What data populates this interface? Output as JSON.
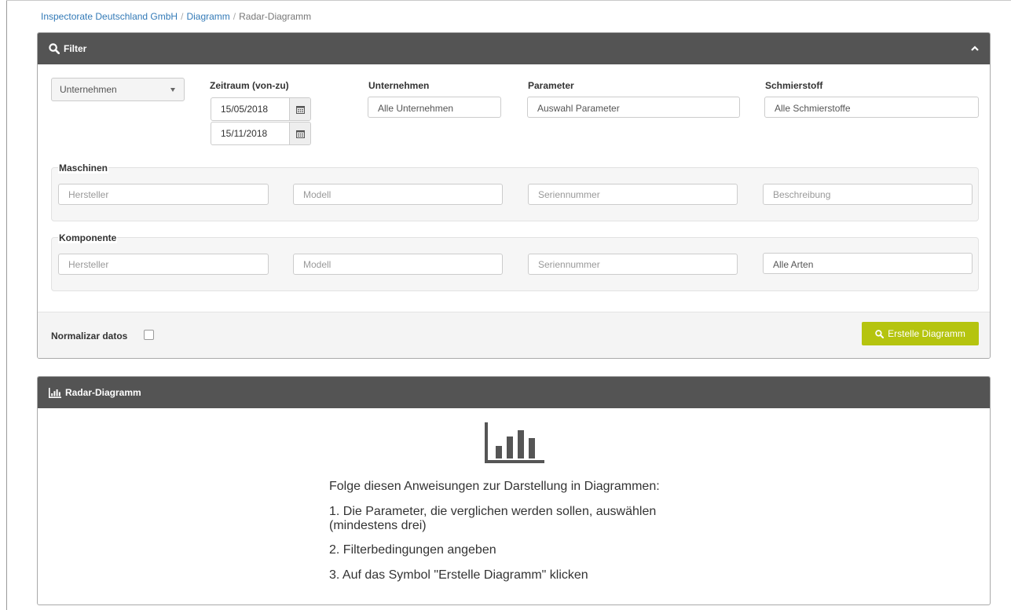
{
  "breadcrumb": {
    "items": [
      "Inspectorate Deutschland GmbH",
      "Diagramm"
    ],
    "current": "Radar-Diagramm",
    "separator": "/"
  },
  "filter_panel": {
    "title": "Filter",
    "collapse_icon": "chevron-up-icon",
    "header_icon": "search-icon",
    "scope_select": {
      "value": "Unternehmen",
      "icon": "caret-down-icon"
    },
    "date_range": {
      "label": "Zeitraum (von-zu)",
      "from": "15/05/2018",
      "to": "15/11/2018",
      "icon": "calendar-icon"
    },
    "company": {
      "label": "Unternehmen",
      "value": "Alle Unternehmen"
    },
    "parameter": {
      "label": "Parameter",
      "value": "Auswahl Parameter"
    },
    "lubricant": {
      "label": "Schmierstoff",
      "value": "Alle Schmierstoffe"
    },
    "machines": {
      "legend": "Maschinen",
      "manufacturer_placeholder": "Hersteller",
      "model_placeholder": "Modell",
      "serial_placeholder": "Seriennummer",
      "description_placeholder": "Beschreibung"
    },
    "component": {
      "legend": "Komponente",
      "manufacturer_placeholder": "Hersteller",
      "model_placeholder": "Modell",
      "serial_placeholder": "Seriennummer",
      "type_value": "Alle Arten"
    },
    "normalize_label": "Normalizar datos",
    "normalize_checked": false,
    "create_button": "Erstelle Diagramm",
    "create_button_color": "#b5c40f"
  },
  "radar_panel": {
    "title": "Radar-Diagramm",
    "header_icon": "bar-chart-icon",
    "placeholder_icon": "bar-chart-icon",
    "instructions_title": "Folge diesen Anweisungen zur Darstellung in Diagrammen:",
    "step1_line1": "1. Die Parameter, die verglichen werden sollen, auswählen",
    "step1_line2": "(mindestens drei)",
    "step2": "2. Filterbedingungen angeben",
    "step3": "3. Auf das Symbol \"Erstelle Diagramm\" klicken"
  },
  "colors": {
    "header_bg": "#545454",
    "link": "#337ab7",
    "accent": "#b5c40f"
  }
}
